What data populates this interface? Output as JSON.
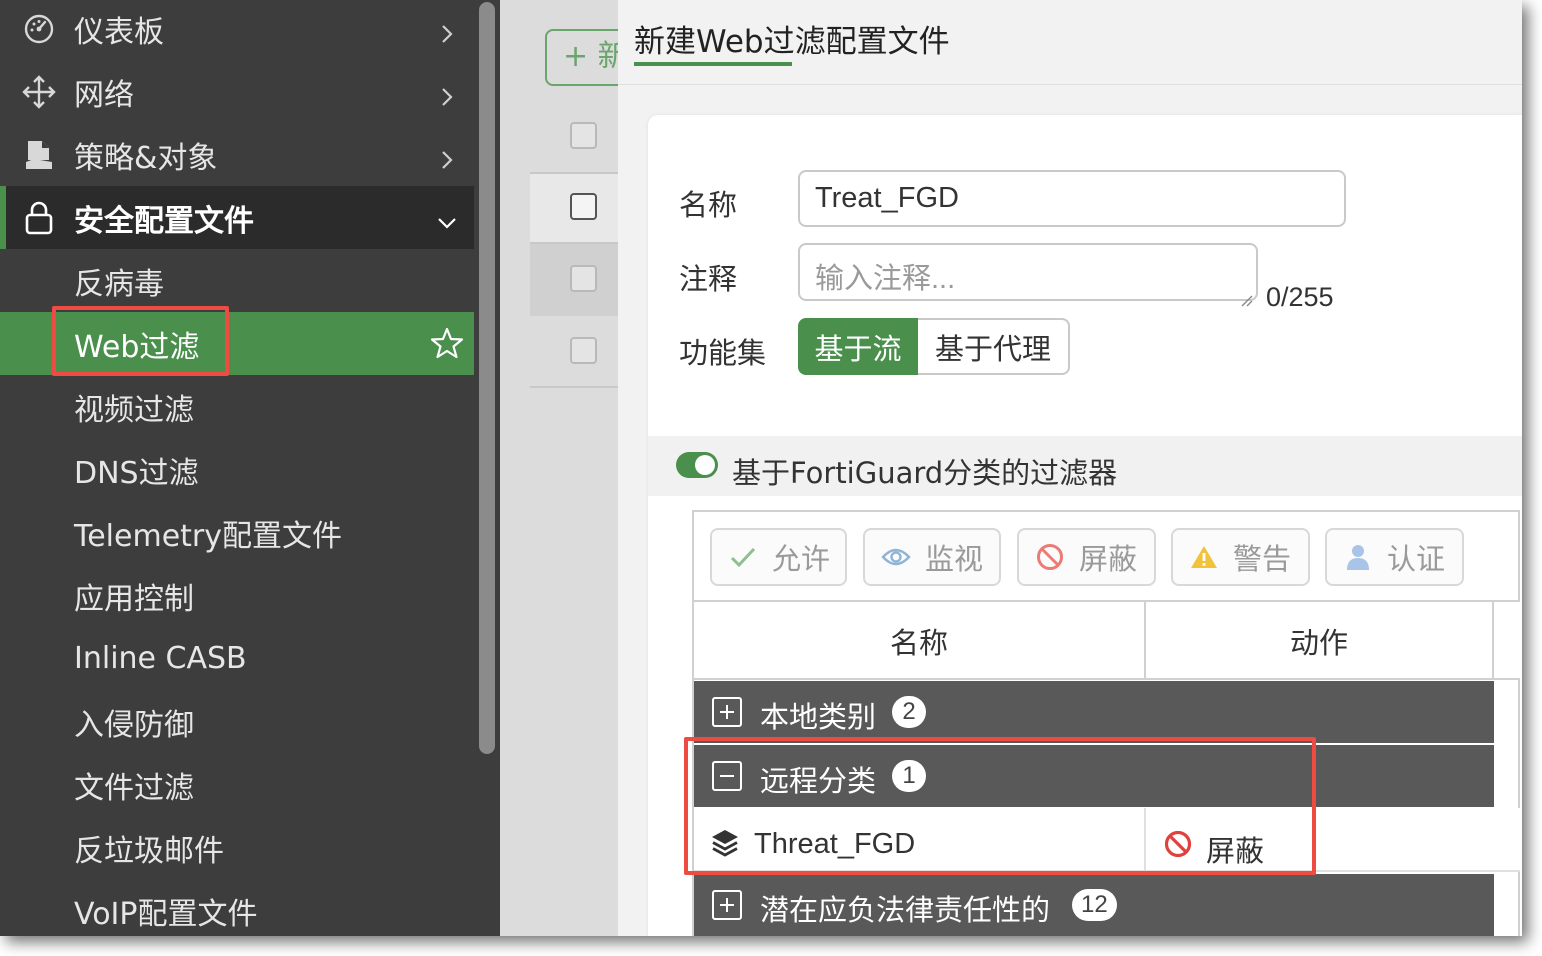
{
  "sidebar": {
    "items": [
      {
        "label": "仪表板",
        "icon": "dashboard-icon"
      },
      {
        "label": "网络",
        "icon": "network-icon"
      },
      {
        "label": "策略&对象",
        "icon": "policy-icon"
      },
      {
        "label": "安全配置文件",
        "icon": "lock-icon"
      }
    ],
    "sub_items": [
      {
        "label": "反病毒"
      },
      {
        "label": "Web过滤"
      },
      {
        "label": "视频过滤"
      },
      {
        "label": "DNS过滤"
      },
      {
        "label": "Telemetry配置文件"
      },
      {
        "label": "应用控制"
      },
      {
        "label": "Inline CASB"
      },
      {
        "label": "入侵防御"
      },
      {
        "label": "文件过滤"
      },
      {
        "label": "反垃圾邮件"
      },
      {
        "label": "VoIP配置文件"
      }
    ]
  },
  "background": {
    "new_button_label": "+ 新"
  },
  "dialog": {
    "title": "新建Web过滤配置文件",
    "name_label": "名称",
    "name_value": "Treat_FGD",
    "comment_label": "注释",
    "comment_placeholder": "输入注释...",
    "comment_counter": "0/255",
    "feature_set_label": "功能集",
    "feature_set_options": [
      "基于流",
      "基于代理"
    ],
    "feature_set_selected": "基于流",
    "fortiguard_toggle_label": "基于FortiGuard分类的过滤器",
    "fortiguard_toggle_on": true
  },
  "toolbar": {
    "allow": "允许",
    "monitor": "监视",
    "block": "屏蔽",
    "warning": "警告",
    "authenticate": "认证"
  },
  "table": {
    "columns": [
      "名称",
      "动作"
    ],
    "groups": [
      {
        "name": "本地类别",
        "count": "2",
        "expanded": false
      },
      {
        "name": "远程分类",
        "count": "1",
        "expanded": true
      },
      {
        "name": "潜在应负法律责任性的",
        "count": "12",
        "expanded": false
      }
    ],
    "rows": [
      {
        "name": "Threat_FGD",
        "action": "屏蔽"
      }
    ]
  },
  "colors": {
    "accent_green": "#4a8f4c",
    "sidebar_bg": "#3d3d3d",
    "highlight_red": "#ee4b42",
    "block_red": "#e0413c",
    "warning_yellow": "#f2c23a"
  }
}
